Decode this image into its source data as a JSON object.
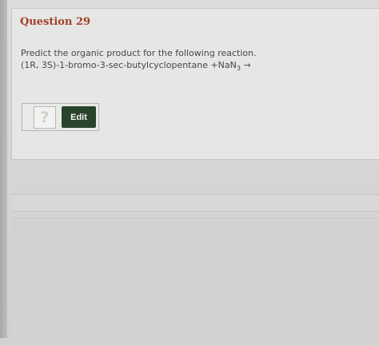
{
  "question": {
    "title": "Question 29",
    "prompt": "Predict the organic product for the following reaction.",
    "reaction_main": "(1R, 3S)-1-bromo-3-sec-butylcyclopentane +NaN",
    "reaction_subscript": "3",
    "reaction_arrow": " →"
  },
  "answer": {
    "placeholder_symbol": "?",
    "edit_label": "Edit"
  },
  "colors": {
    "title": "#a0402a",
    "edit_button": "#2a432c"
  }
}
